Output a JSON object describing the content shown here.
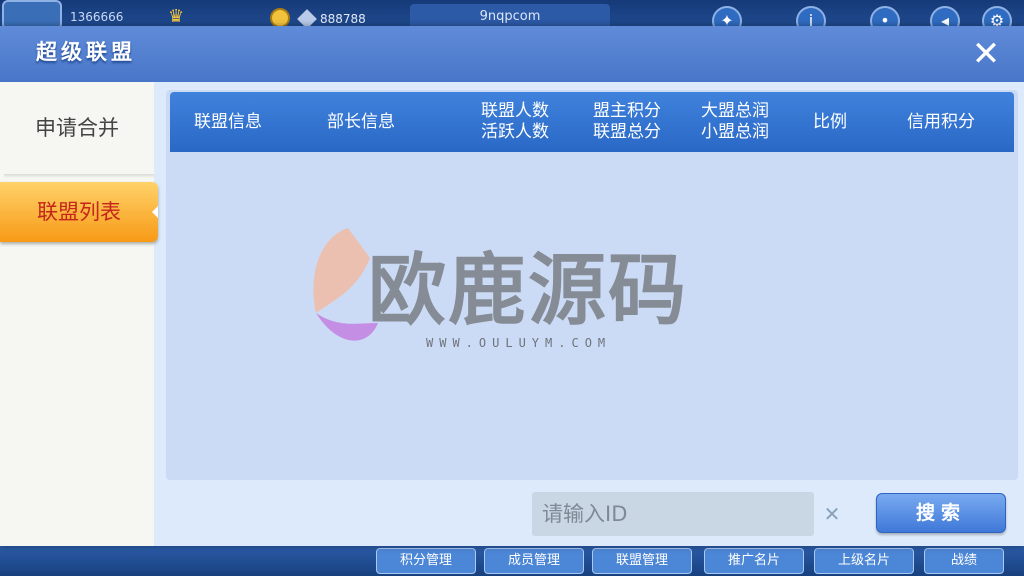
{
  "background": {
    "player_id": "1366666",
    "coins": "888788",
    "site": "9nqpcom",
    "bottom_buttons": [
      "积分管理",
      "成员管理",
      "联盟管理",
      "推广名片",
      "上级名片",
      "战绩"
    ]
  },
  "dialog": {
    "title": "超级联盟",
    "close_symbol": "✕",
    "sidebar": {
      "tabs": [
        {
          "label": "申请合并",
          "active": false
        },
        {
          "label": "联盟列表",
          "active": true
        }
      ]
    },
    "table": {
      "columns": [
        {
          "line1": "联盟信息",
          "line2": ""
        },
        {
          "line1": "部长信息",
          "line2": ""
        },
        {
          "line1": "联盟人数",
          "line2": "活跃人数"
        },
        {
          "line1": "盟主积分",
          "line2": "联盟总分"
        },
        {
          "line1": "大盟总润",
          "line2": "小盟总润"
        },
        {
          "line1": "比例",
          "line2": ""
        },
        {
          "line1": "信用积分",
          "line2": ""
        }
      ],
      "rows": []
    },
    "watermark": {
      "text": "欧鹿源码",
      "url": "WWW.OULUYM.COM"
    },
    "search": {
      "placeholder": "请输入ID",
      "value": "",
      "button_label": "搜索"
    }
  },
  "colors": {
    "title_bar": "#4a76c9",
    "active_tab": "#f79a16",
    "active_tab_text": "#c4261a",
    "table_header": "#2a68c6"
  }
}
